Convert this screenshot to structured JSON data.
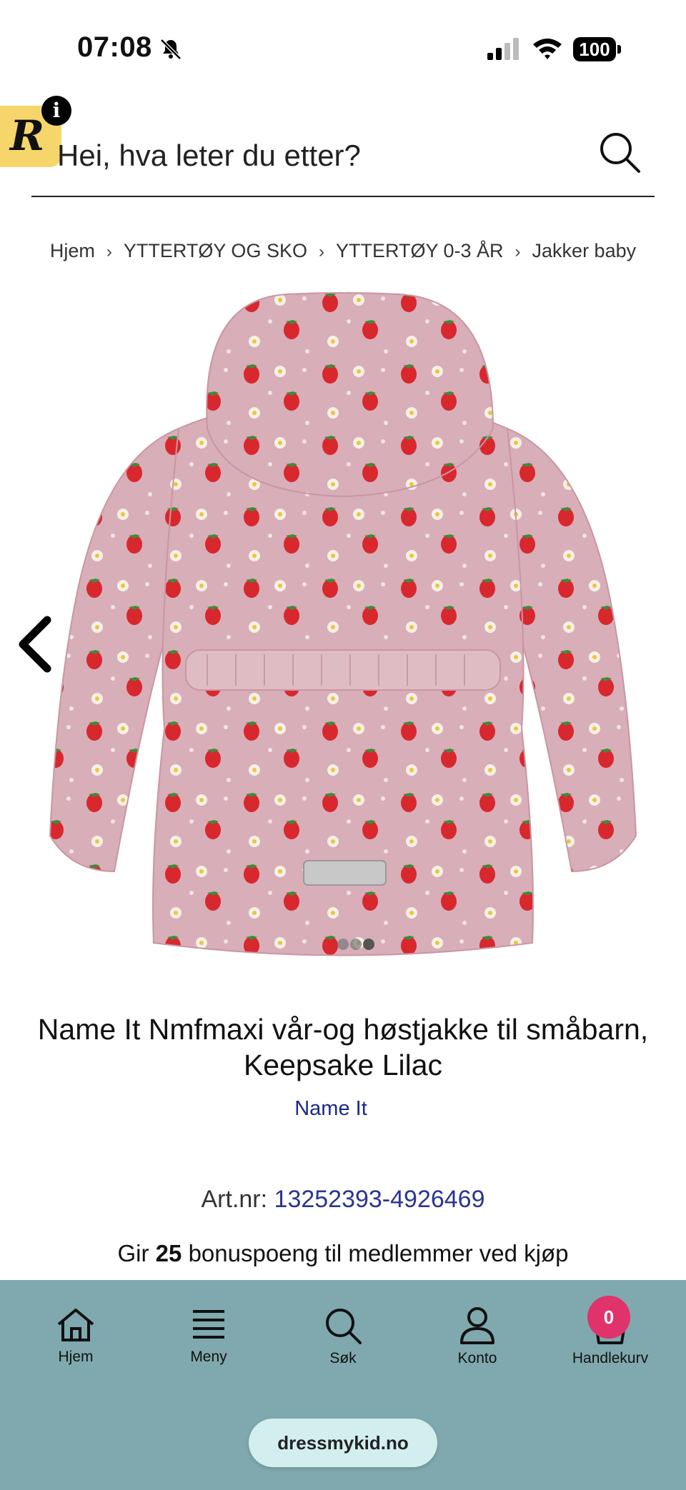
{
  "status_bar": {
    "time": "07:08",
    "battery": "100"
  },
  "badge": {
    "letter": "R",
    "info": "i"
  },
  "search": {
    "placeholder": "Hei, hva leter du etter?"
  },
  "breadcrumb": [
    "Hjem",
    "YTTERTØY OG SKO",
    "YTTERTØY 0-3 ÅR",
    "Jakker baby"
  ],
  "product": {
    "title_line1": "Name It Nmfmaxi vår-og høstjakke til småbarn,",
    "title_line2": "Keepsake Lilac",
    "brand": "Name It",
    "artnr_label": "Art.nr:",
    "artnr_value": "13252393-4926469",
    "bonus_prefix": "Gir",
    "bonus_points": "25",
    "bonus_suffix": "bonuspoeng til medlemmer ved kjøp"
  },
  "nav": {
    "home": "Hjem",
    "menu": "Meny",
    "search": "Søk",
    "account": "Konto",
    "cart": "Handlekurv",
    "cart_count": "0"
  },
  "browser": {
    "domain": "dressmykid.no"
  },
  "colors": {
    "nav_bg": "#7fa9ae",
    "cart_badge": "#e0336c",
    "link": "#1c2a8a",
    "jacket": "#d8aeb8"
  }
}
